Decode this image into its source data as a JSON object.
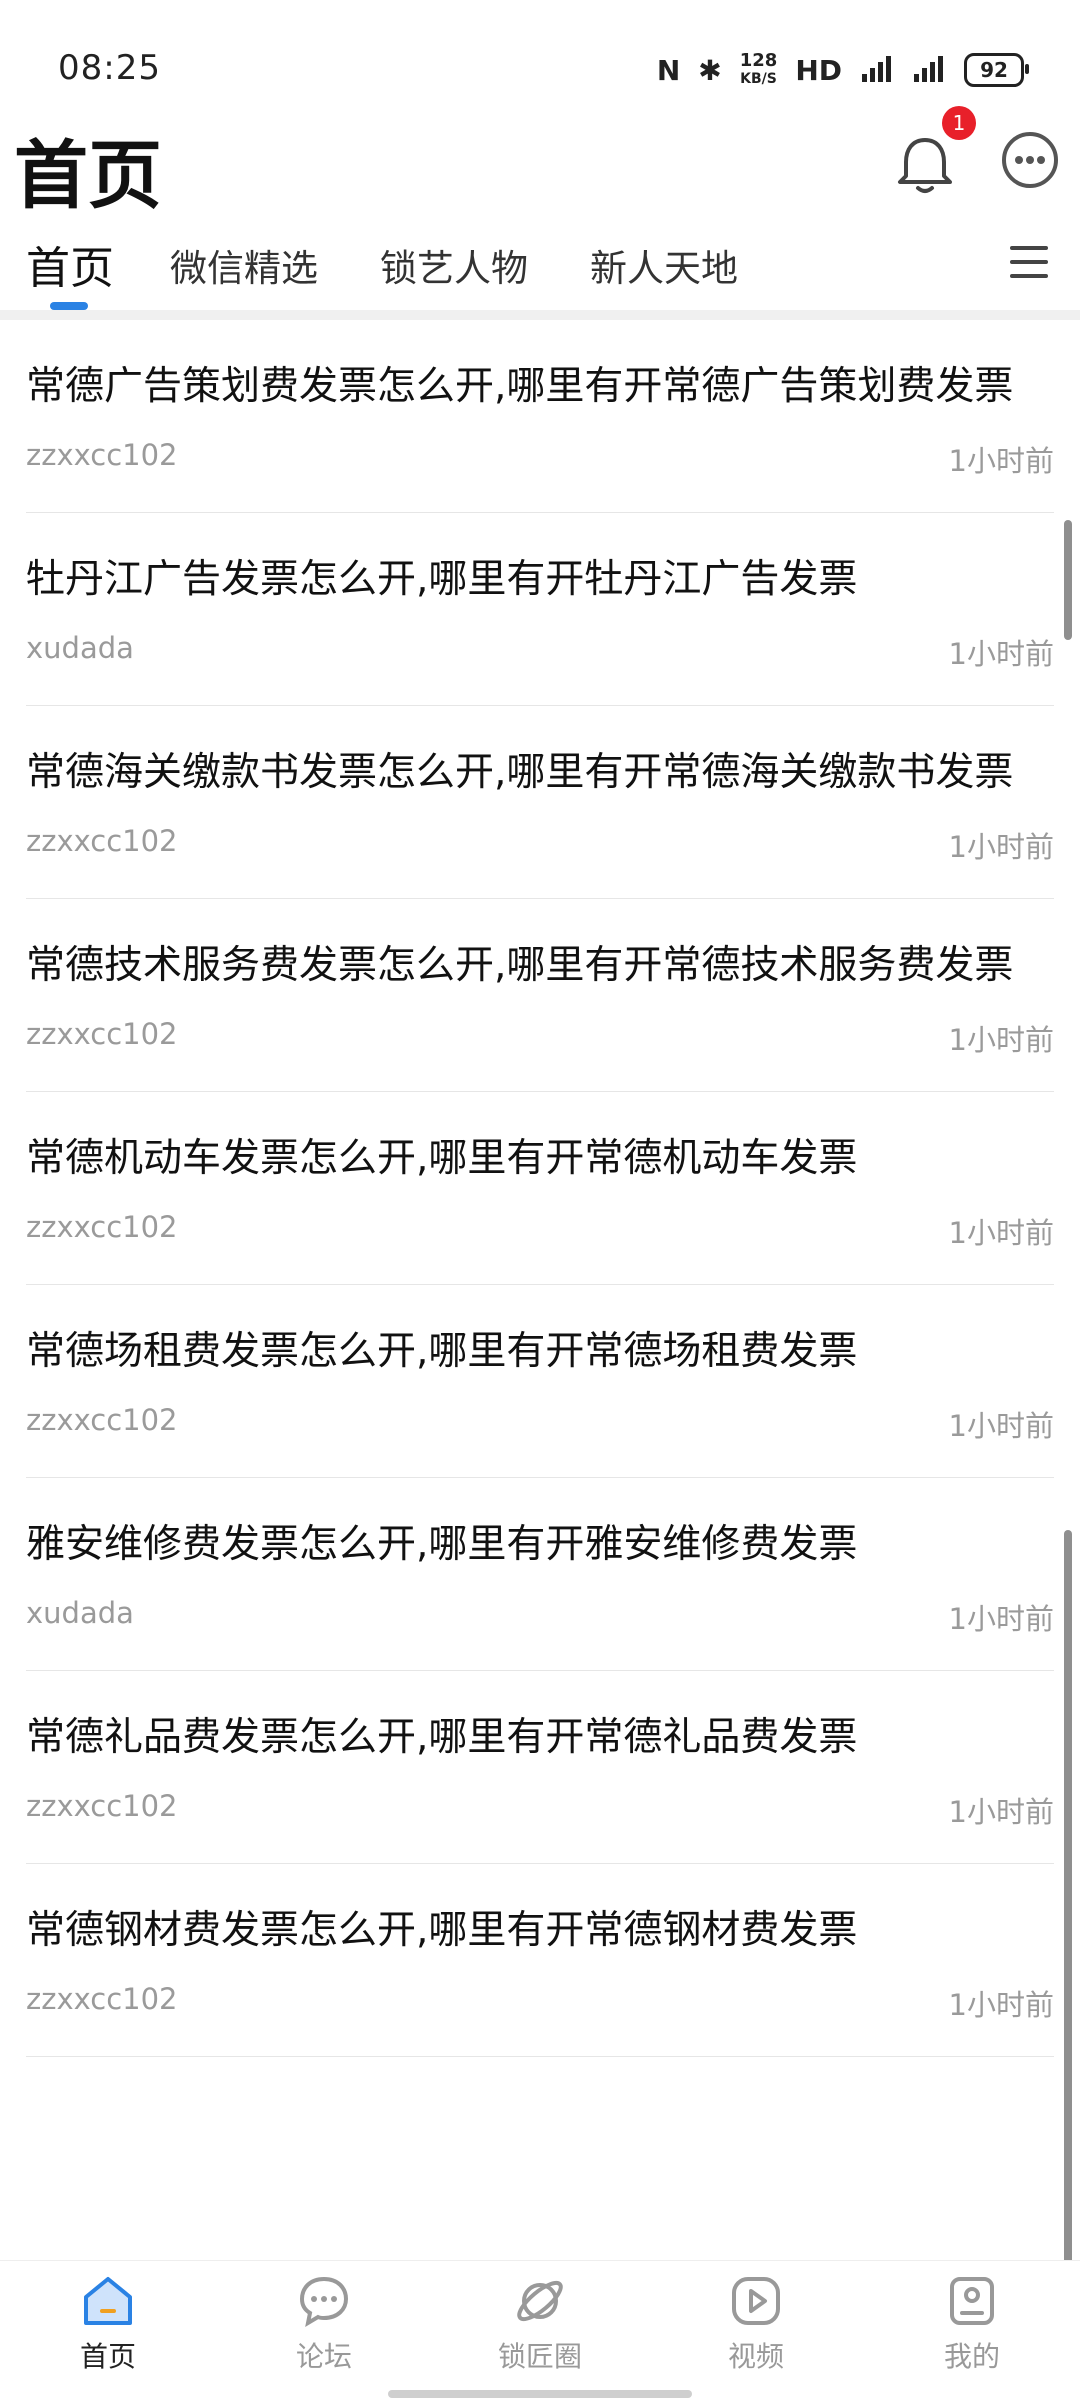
{
  "status_bar": {
    "time": "08:25",
    "speed_value": "128",
    "speed_unit": "KB/S",
    "hd": "HD",
    "battery": "92"
  },
  "header": {
    "title": "首页",
    "notification_count": "1"
  },
  "tabs": [
    "首页",
    "微信精选",
    "锁艺人物",
    "新人天地"
  ],
  "posts": [
    {
      "title": "常德广告策划费发票怎么开,哪里有开常德广告策划费发票",
      "author": "zzxxcc102",
      "time": "1小时前"
    },
    {
      "title": "牡丹江广告发票怎么开,哪里有开牡丹江广告发票",
      "author": "xudada",
      "time": "1小时前"
    },
    {
      "title": "常德海关缴款书发票怎么开,哪里有开常德海关缴款书发票",
      "author": "zzxxcc102",
      "time": "1小时前"
    },
    {
      "title": "常德技术服务费发票怎么开,哪里有开常德技术服务费发票",
      "author": "zzxxcc102",
      "time": "1小时前"
    },
    {
      "title": "常德机动车发票怎么开,哪里有开常德机动车发票",
      "author": "zzxxcc102",
      "time": "1小时前"
    },
    {
      "title": "常德场租费发票怎么开,哪里有开常德场租费发票",
      "author": "zzxxcc102",
      "time": "1小时前"
    },
    {
      "title": "雅安维修费发票怎么开,哪里有开雅安维修费发票",
      "author": "xudada",
      "time": "1小时前"
    },
    {
      "title": "常德礼品费发票怎么开,哪里有开常德礼品费发票",
      "author": "zzxxcc102",
      "time": "1小时前"
    },
    {
      "title": "常德钢材费发票怎么开,哪里有开常德钢材费发票",
      "author": "zzxxcc102",
      "time": "1小时前"
    }
  ],
  "bottom_nav": [
    {
      "label": "首页",
      "icon": "home-icon"
    },
    {
      "label": "论坛",
      "icon": "forum-icon"
    },
    {
      "label": "锁匠圈",
      "icon": "planet-icon"
    },
    {
      "label": "视频",
      "icon": "video-icon"
    },
    {
      "label": "我的",
      "icon": "profile-icon"
    }
  ],
  "colors": {
    "accent": "#2a82e4",
    "badge": "#e8202a",
    "meta_text": "#9a9a9a"
  }
}
